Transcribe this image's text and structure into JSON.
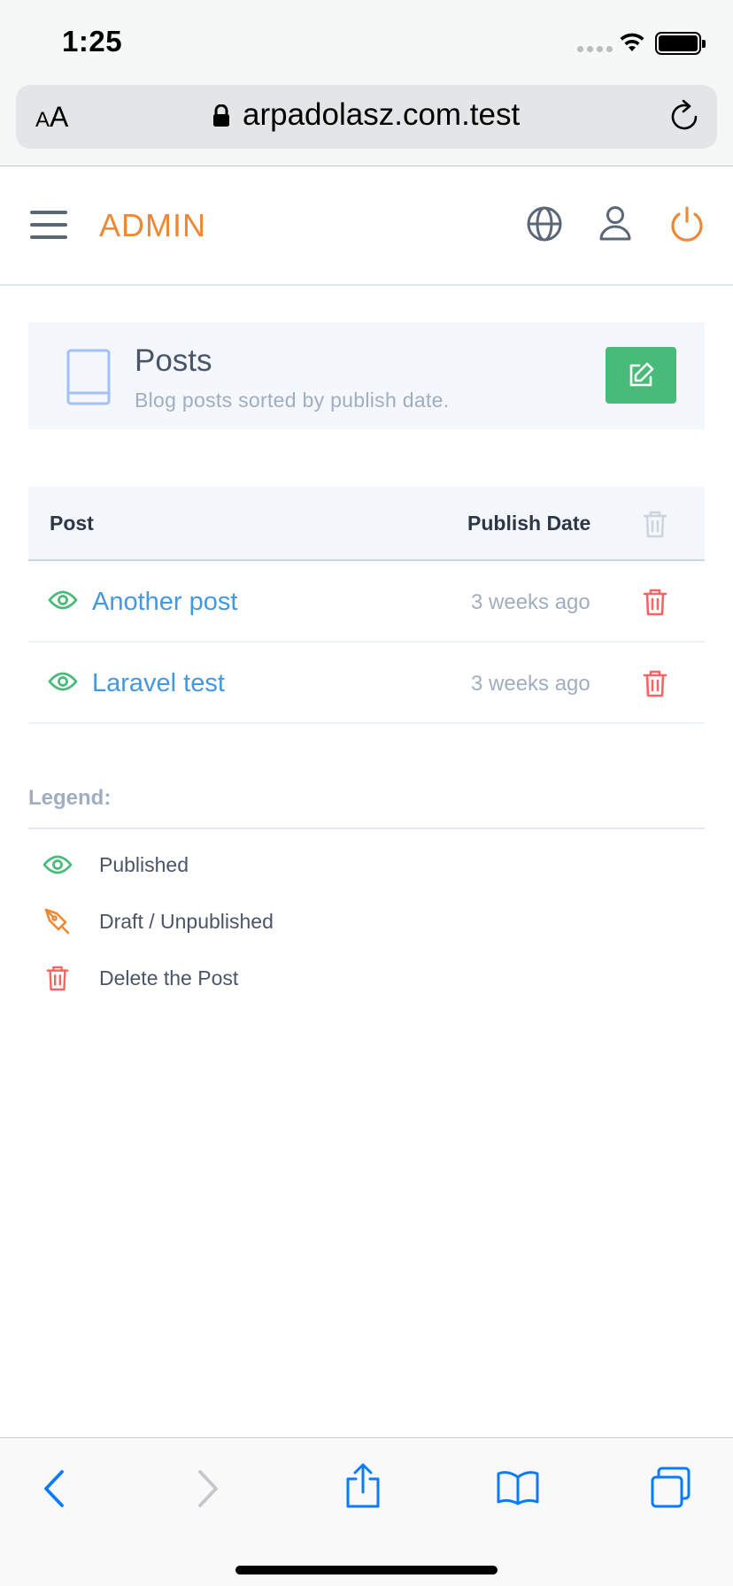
{
  "status": {
    "time": "1:25"
  },
  "browser": {
    "text_size_label_small": "A",
    "text_size_label_large": "A",
    "url": "arpadolasz.com.test"
  },
  "header": {
    "brand": "ADMIN",
    "icons": [
      "menu-icon",
      "globe-icon",
      "user-icon",
      "power-icon"
    ],
    "brand_color": "#ed8936"
  },
  "panel": {
    "title": "Posts",
    "subtitle": "Blog posts sorted by publish date.",
    "icon": "book-icon",
    "action_icon": "edit-icon",
    "action_color": "#48bb78"
  },
  "table": {
    "columns": [
      "Post",
      "Publish Date"
    ],
    "rows": [
      {
        "status": "published",
        "title": "Another post",
        "date": "3 weeks ago"
      },
      {
        "status": "published",
        "title": "Laravel test",
        "date": "3 weeks ago"
      }
    ]
  },
  "legend": {
    "title": "Legend:",
    "items": [
      {
        "icon": "eye-icon",
        "label": "Published",
        "color": "#48bb78"
      },
      {
        "icon": "pen-icon",
        "label": "Draft / Unpublished",
        "color": "#ed8936"
      },
      {
        "icon": "trash-icon",
        "label": "Delete the Post",
        "color": "#f56565"
      }
    ]
  },
  "colors": {
    "link": "#4299e1",
    "danger": "#f56565",
    "success": "#48bb78",
    "muted": "#a0aec0",
    "ios_blue": "#0a7aff"
  }
}
